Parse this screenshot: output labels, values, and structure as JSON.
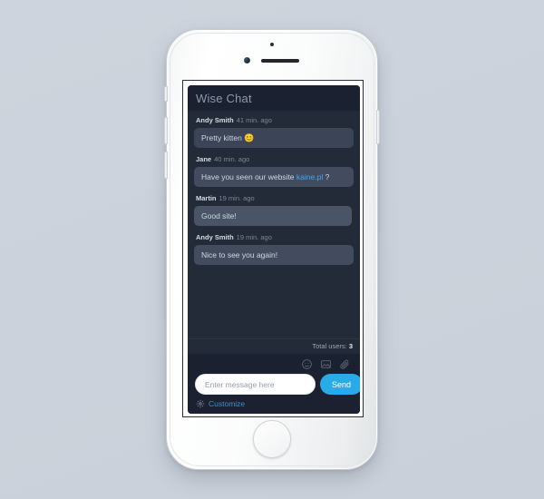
{
  "device": {
    "name": "smartphone-mockup",
    "sensors": {
      "earpiece": "speaker-grille",
      "camera": "front-camera",
      "proximity": "proximity-sensor-dot"
    },
    "buttons": {
      "silent": "silent-switch",
      "volume_up": "volume-up-button",
      "volume_down": "volume-down-button",
      "power": "power-button",
      "home": "home-button"
    }
  },
  "chat": {
    "header": {
      "title": "Wise Chat"
    },
    "messages": [
      {
        "author": "Andy Smith",
        "time": "41 min. ago",
        "text": "Pretty kitten ",
        "emoji": "😊",
        "tone": "tone-a"
      },
      {
        "author": "Jane",
        "time": "40 min. ago",
        "text_before": "Have you seen our website ",
        "link": "kaine.pl",
        "text_after": " ?",
        "tone": "tone-b"
      },
      {
        "author": "Martin",
        "time": "19 min. ago",
        "text": "Good site!",
        "emoji": "",
        "tone": "tone-c"
      },
      {
        "author": "Andy Smith",
        "time": "19 min. ago",
        "text": "Nice to see you again!",
        "emoji": "",
        "tone": "tone-b"
      }
    ],
    "status": {
      "users_label": "Total users:",
      "users_count": "3"
    },
    "tools": [
      {
        "name": "emoji-icon",
        "title": "Emoji"
      },
      {
        "name": "image-icon",
        "title": "Image"
      },
      {
        "name": "attachment-icon",
        "title": "Attachment"
      }
    ],
    "composer": {
      "input_value": "",
      "input_placeholder": "Enter message here",
      "send_label": "Send"
    },
    "customize": {
      "label": "Customize",
      "icon": "gear-icon"
    },
    "colors": {
      "widget_bg": "#1f2533",
      "header_bg": "#1b2130",
      "messages_bg": "#232a38",
      "bubble_a": "#3b4557",
      "bubble_b": "#424c5e",
      "bubble_c": "#4a5467",
      "accent_send": "#29abe8",
      "link": "#3fa9f5",
      "customize_link": "#3a8fd4",
      "page_bg": "#ccd3dc"
    }
  }
}
